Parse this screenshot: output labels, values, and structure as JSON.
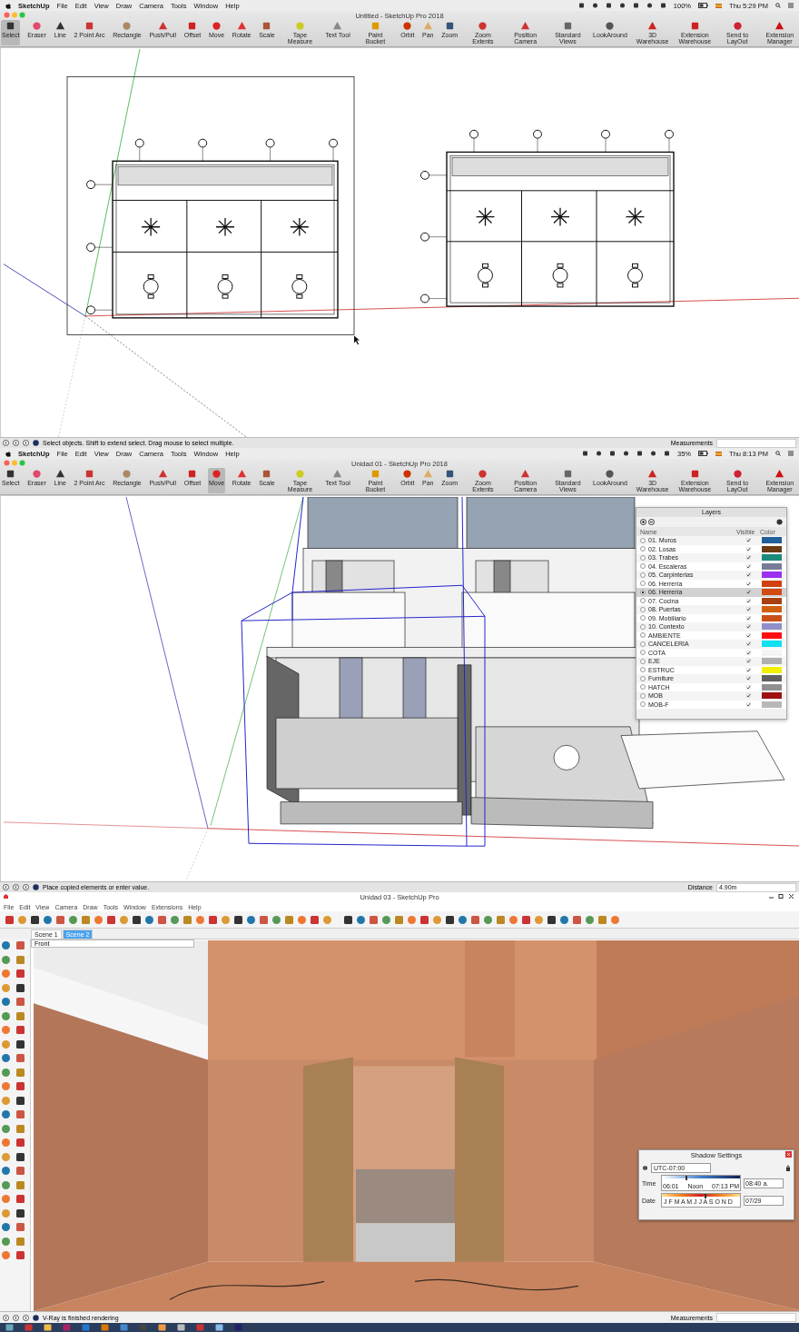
{
  "panels": [
    {
      "kind": "mac",
      "menubar": {
        "app": "SketchUp",
        "menus": [
          "File",
          "Edit",
          "View",
          "Draw",
          "Camera",
          "Tools",
          "Window",
          "Help"
        ],
        "battery": "100%",
        "clock": "Thu 5:29 PM"
      },
      "title": "Untitled - SketchUp Pro 2018",
      "tools": [
        {
          "label": "Select",
          "selected": true
        },
        {
          "label": "Eraser",
          "selected": false
        },
        {
          "label": "Line",
          "selected": false
        },
        {
          "label": "2 Point Arc",
          "selected": false
        },
        {
          "label": "Rectangle",
          "selected": false
        },
        {
          "label": "Push/Pull",
          "selected": false
        },
        {
          "label": "Offset",
          "selected": false
        },
        {
          "label": "Move",
          "selected": false
        },
        {
          "label": "Rotate",
          "selected": false
        },
        {
          "label": "Scale",
          "selected": false
        },
        {
          "label": "Tape Measure",
          "selected": false
        },
        {
          "label": "Text Tool",
          "selected": false
        },
        {
          "label": "Paint Bucket",
          "selected": false
        },
        {
          "label": "Orbit",
          "selected": false
        },
        {
          "label": "Pan",
          "selected": false
        },
        {
          "label": "Zoom",
          "selected": false
        },
        {
          "label": "Zoom Extents",
          "selected": false
        },
        {
          "label": "Position Camera",
          "selected": false
        },
        {
          "label": "Standard Views",
          "selected": false
        },
        {
          "label": "LookAround",
          "selected": false
        },
        {
          "label": "3D Warehouse",
          "selected": false
        },
        {
          "label": "Extension Warehouse",
          "selected": false
        },
        {
          "label": "Send to LayOut",
          "selected": false
        },
        {
          "label": "Extension Manager",
          "selected": false
        }
      ],
      "viewport": {
        "kind": "plan"
      },
      "status": {
        "message": "Select objects. Shift to extend select. Drag mouse to select multiple.",
        "measure_label": "Measurements"
      }
    },
    {
      "kind": "mac",
      "menubar": {
        "app": "SketchUp",
        "menus": [
          "File",
          "Edit",
          "View",
          "Draw",
          "Camera",
          "Tools",
          "Window",
          "Help"
        ],
        "battery": "35%",
        "clock": "Thu 8:13 PM"
      },
      "title": "Unidad 01 - SketchUp Pro 2018",
      "tools": [
        {
          "label": "Select",
          "selected": false
        },
        {
          "label": "Eraser",
          "selected": false
        },
        {
          "label": "Line",
          "selected": false
        },
        {
          "label": "2 Point Arc",
          "selected": false
        },
        {
          "label": "Rectangle",
          "selected": false
        },
        {
          "label": "Push/Pull",
          "selected": false
        },
        {
          "label": "Offset",
          "selected": false
        },
        {
          "label": "Move",
          "selected": true
        },
        {
          "label": "Rotate",
          "selected": false
        },
        {
          "label": "Scale",
          "selected": false
        },
        {
          "label": "Tape Measure",
          "selected": false
        },
        {
          "label": "Text Tool",
          "selected": false
        },
        {
          "label": "Paint Bucket",
          "selected": false
        },
        {
          "label": "Orbit",
          "selected": false
        },
        {
          "label": "Pan",
          "selected": false
        },
        {
          "label": "Zoom",
          "selected": false
        },
        {
          "label": "Zoom Extents",
          "selected": false
        },
        {
          "label": "Position Camera",
          "selected": false
        },
        {
          "label": "Standard Views",
          "selected": false
        },
        {
          "label": "LookAround",
          "selected": false
        },
        {
          "label": "3D Warehouse",
          "selected": false
        },
        {
          "label": "Extension Warehouse",
          "selected": false
        },
        {
          "label": "Send to LayOut",
          "selected": false
        },
        {
          "label": "Extension Manager",
          "selected": false
        }
      ],
      "viewport": {
        "kind": "model",
        "layers": {
          "title": "Layers",
          "columns": [
            "Name",
            "Visible",
            "Color"
          ],
          "rows": [
            {
              "name": "01. Muros",
              "selected": false,
              "visible": true,
              "color": "#1f5f9a"
            },
            {
              "name": "02. Losas",
              "selected": false,
              "visible": true,
              "color": "#6b3a10"
            },
            {
              "name": "03. Trabes",
              "selected": false,
              "visible": true,
              "color": "#1a8a7a"
            },
            {
              "name": "04. Escaleras",
              "selected": false,
              "visible": true,
              "color": "#7a7a9a"
            },
            {
              "name": "05. Carpinterias",
              "selected": false,
              "visible": true,
              "color": "#9b30f0"
            },
            {
              "name": "06. Herrería",
              "selected": false,
              "visible": true,
              "color": "#d04010"
            },
            {
              "name": "06. Herrería",
              "selected": true,
              "visible": true,
              "color": "#d04a12"
            },
            {
              "name": "07. Cocina",
              "selected": false,
              "visible": true,
              "color": "#a84010"
            },
            {
              "name": "08. Puertas",
              "selected": false,
              "visible": true,
              "color": "#d06010"
            },
            {
              "name": "09. Mobiliario",
              "selected": false,
              "visible": true,
              "color": "#c85018"
            },
            {
              "name": "10. Contexto",
              "selected": false,
              "visible": true,
              "color": "#9090c8"
            },
            {
              "name": "AMBIENTE",
              "selected": false,
              "visible": true,
              "color": "#ff1010"
            },
            {
              "name": "CANCELERIA",
              "selected": false,
              "visible": true,
              "color": "#10e0f0"
            },
            {
              "name": "COTA",
              "selected": false,
              "visible": true,
              "color": "#f4f4f4"
            },
            {
              "name": "EJE",
              "selected": false,
              "visible": true,
              "color": "#b0b0b0"
            },
            {
              "name": "ESTRUC",
              "selected": false,
              "visible": true,
              "color": "#f0f000"
            },
            {
              "name": "Furniture",
              "selected": false,
              "visible": true,
              "color": "#606060"
            },
            {
              "name": "HATCH",
              "selected": false,
              "visible": true,
              "color": "#909090"
            },
            {
              "name": "MOB",
              "selected": false,
              "visible": true,
              "color": "#a01010"
            },
            {
              "name": "MOB-F",
              "selected": false,
              "visible": true,
              "color": "#b8b8b8"
            }
          ]
        }
      },
      "status": {
        "message": "Place copied elements or enter value.",
        "measure_label": "Distance",
        "measure_value": "4.90m"
      }
    },
    {
      "kind": "windows",
      "title": "Unidad 03 - SketchUp Pro",
      "menus": [
        "File",
        "Edit",
        "View",
        "Camera",
        "Draw",
        "Tools",
        "Window",
        "Extensions",
        "Help"
      ],
      "scenes": [
        {
          "label": "Scene 1",
          "selected": false
        },
        {
          "label": "Scene 2",
          "selected": true
        }
      ],
      "viewport": {
        "kind": "render",
        "view_label": "Front",
        "shadow": {
          "title": "Shadow Settings",
          "timezone": "UTC-07:00",
          "time": {
            "label": "Time",
            "sunrise": "06:01",
            "noon": "Noon",
            "sunset": "07:13 PM",
            "value": "08:40 a.",
            "level": 0.3
          },
          "date": {
            "label": "Date",
            "months": "J F M A M J J A S O N D",
            "value": "07/29",
            "level": 0.55
          }
        }
      },
      "status": {
        "message": "V-Ray is finished rendering",
        "measure_label": "Measurements"
      }
    }
  ]
}
